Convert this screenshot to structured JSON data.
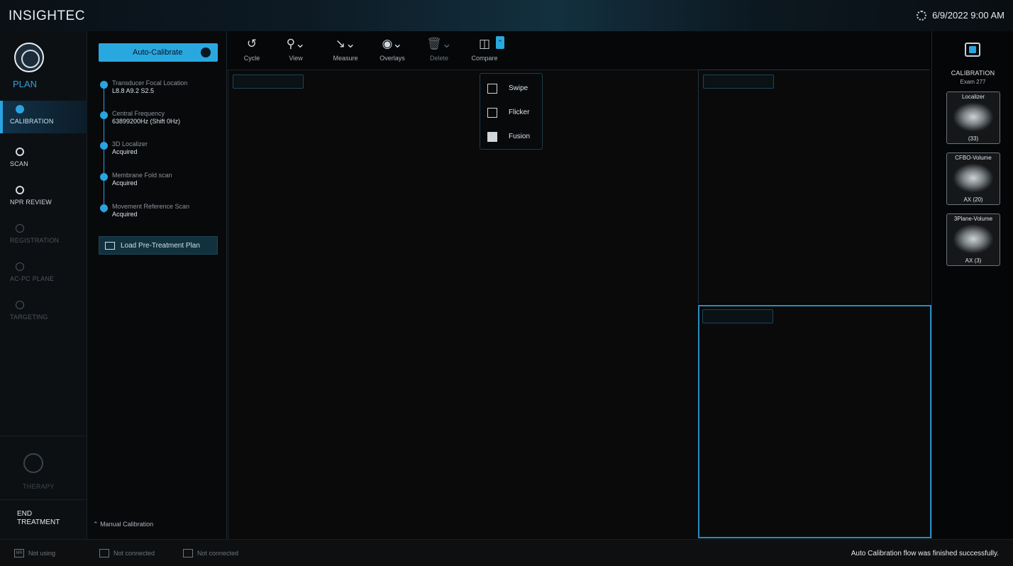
{
  "header": {
    "logo": "INSIGHTEC",
    "datetime": "6/9/2022 9:00 AM"
  },
  "leftnav": {
    "plan_label": "PLAN",
    "items": [
      {
        "label": "CALIBRATION",
        "state": "active"
      },
      {
        "label": "SCAN",
        "state": "done"
      },
      {
        "label": "NPR REVIEW",
        "state": "done"
      },
      {
        "label": "REGISTRATION",
        "state": "dim"
      },
      {
        "label": "AC-PC PLANE",
        "state": "dim"
      },
      {
        "label": "TARGETING",
        "state": "dim"
      }
    ],
    "therapy_label": "THERAPY",
    "end_treatment_label": "END\nTREATMENT"
  },
  "calibration": {
    "auto_calibrate_label": "Auto-Calibrate",
    "steps": [
      {
        "title": "Transducer Focal Location",
        "value": "L8.8 A9.2 S2.5"
      },
      {
        "title": "Central Frequency",
        "value": "63899200Hz (Shift 0Hz)"
      },
      {
        "title": "3D Localizer",
        "value": "Acquired"
      },
      {
        "title": "Membrane Fold scan",
        "value": "Acquired"
      },
      {
        "title": "Movement Reference Scan",
        "value": "Acquired"
      }
    ],
    "load_plan_label": "Load Pre-Treatment Plan",
    "manual_label": "Manual Calibration"
  },
  "toolbar": {
    "cycle": "Cycle",
    "view": "View",
    "measure": "Measure",
    "overlays": "Overlays",
    "delete": "Delete",
    "compare": "Compare"
  },
  "compare_menu": {
    "swipe": "Swipe",
    "flicker": "Flicker",
    "fusion": "Fusion"
  },
  "rightpanel": {
    "title": "CALIBRATION",
    "subtitle": "Exam 277",
    "thumbs": [
      {
        "name": "Localizer",
        "caption": "(33)"
      },
      {
        "name": "CFBO-Volume",
        "caption": "AX (20)"
      },
      {
        "name": "3Plane-Volume",
        "caption": "AX (3)"
      }
    ]
  },
  "statusbar": {
    "mr": "Not using",
    "mr_icon": "MR",
    "conn1": "Not connected",
    "conn2": "Not connected",
    "message": "Auto Calibration flow was finished successfully."
  },
  "colors": {
    "accent": "#29a8e0",
    "background": "#050608"
  }
}
